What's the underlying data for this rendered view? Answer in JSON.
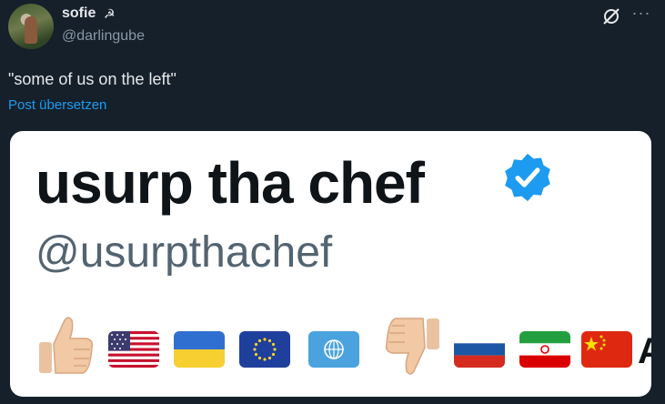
{
  "author": {
    "name": "sofie",
    "name_icon": "☭",
    "handle": "@darlingube"
  },
  "tweet": {
    "text": "\"some of us on the left\"",
    "translate_label": "Post übersetzen"
  },
  "header_icons": {
    "grok": "grok-icon",
    "more": "···"
  },
  "media": {
    "display_name": "usurp tha chef",
    "handle": "@usurpthachef",
    "verified_color": "#1d9bf0",
    "emojis": [
      {
        "name": "thumbs-up-icon"
      },
      {
        "name": "flag-usa-icon"
      },
      {
        "name": "flag-ukraine-icon"
      },
      {
        "name": "flag-eu-icon"
      },
      {
        "name": "flag-un-icon"
      },
      {
        "name": "thumbs-down-icon"
      },
      {
        "name": "flag-russia-icon"
      },
      {
        "name": "flag-iran-icon"
      },
      {
        "name": "flag-china-icon"
      }
    ],
    "trailing_text": "A"
  },
  "colors": {
    "background": "#15202b",
    "link": "#1d9bf0",
    "secondary_text": "#8b98a5"
  }
}
